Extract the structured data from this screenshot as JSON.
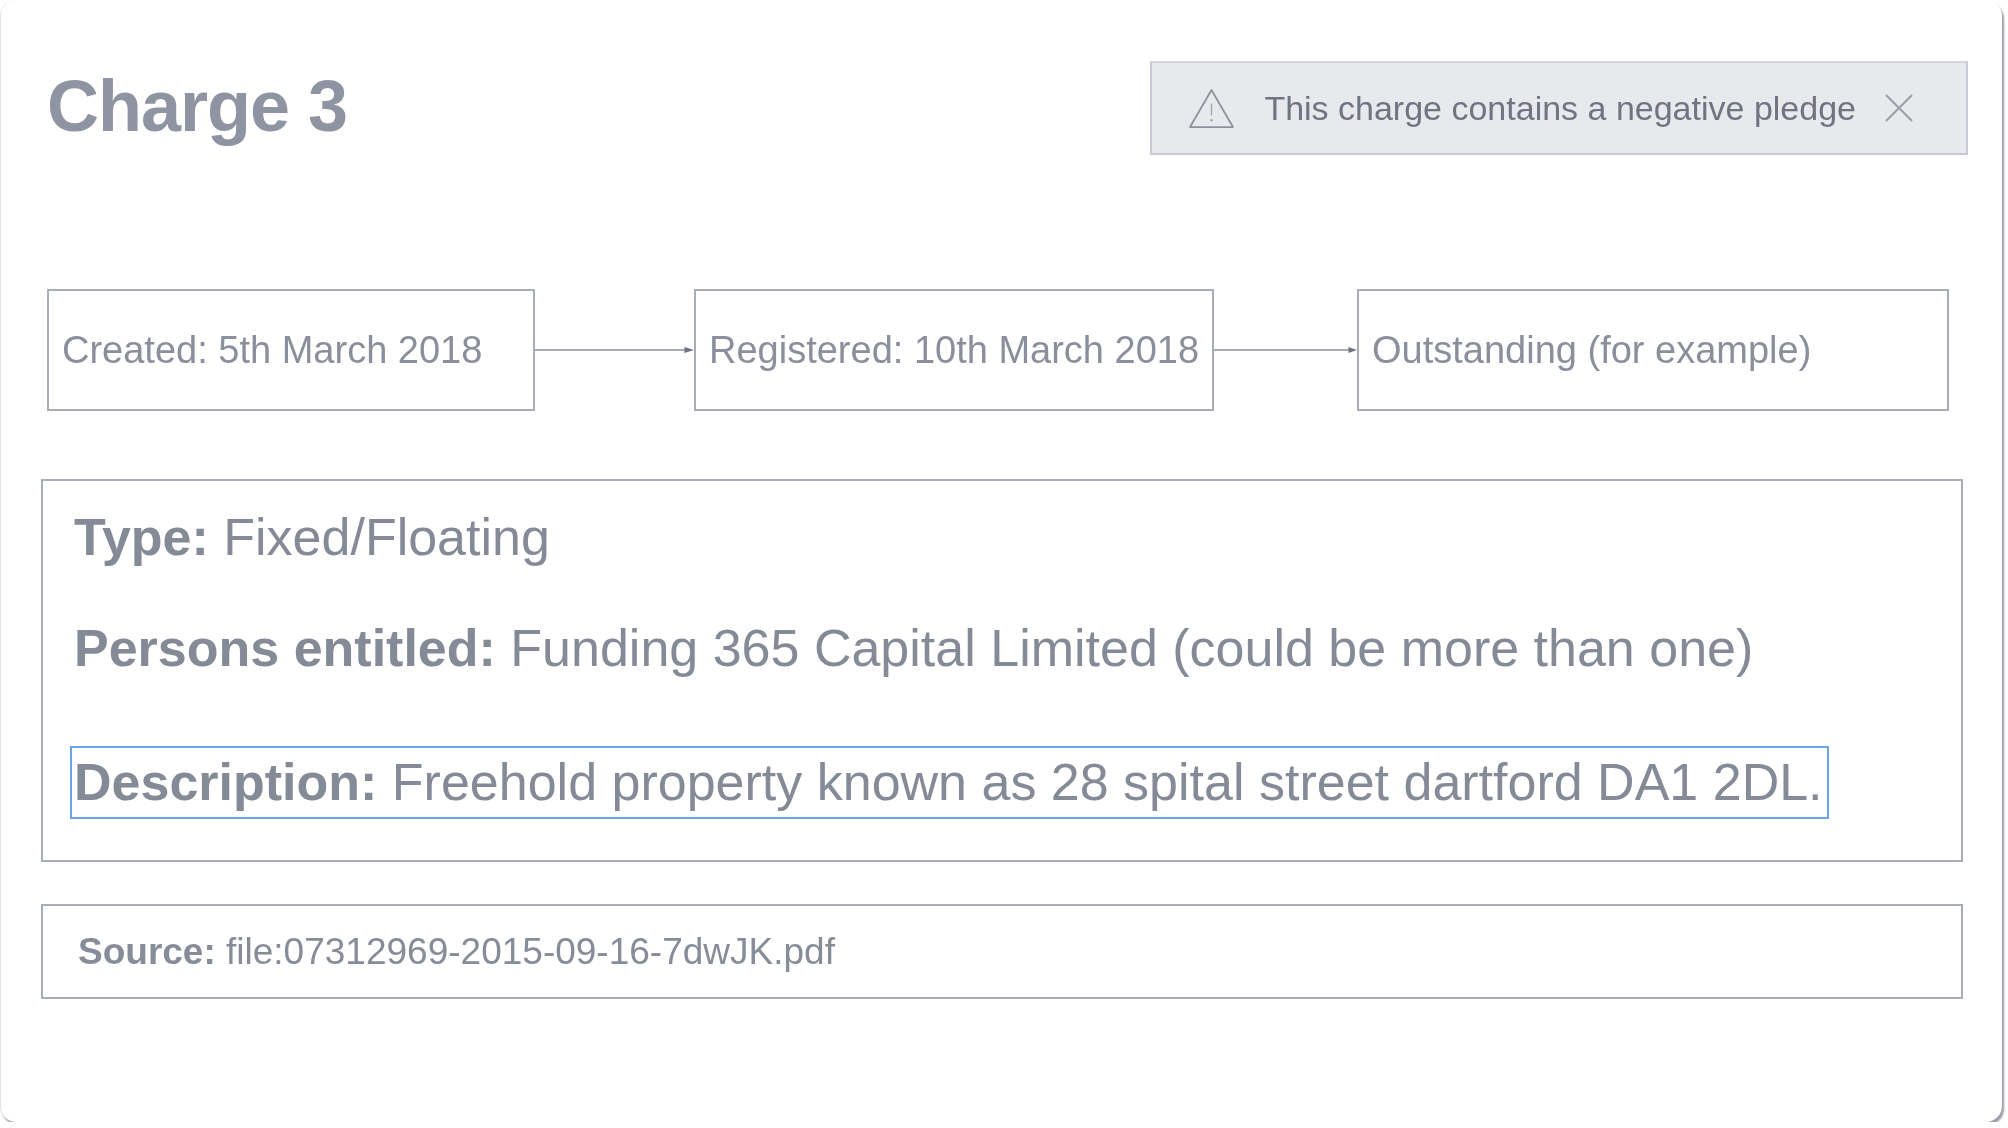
{
  "title": "Charge 3",
  "alert": {
    "message": "This charge contains a negative pledge"
  },
  "timeline": [
    {
      "text": "Created: 5th March 2018"
    },
    {
      "text": "Registered: 10th March 2018"
    },
    {
      "text": "Outstanding (for example)"
    }
  ],
  "details": [
    {
      "text": "**Type:** Fixed/Floating",
      "highlighted": false
    },
    {
      "text": "**Persons entitled:** Funding 365 Capital Limited (could be more than one)",
      "highlighted": false
    },
    {
      "text": "**Description:** Freehold property known as 28 spital street dartford DA1 2DL.",
      "highlighted": true
    }
  ],
  "source": {
    "text": "**Source:** file:07312969-2015-09-16-7dwJK.pdf"
  }
}
